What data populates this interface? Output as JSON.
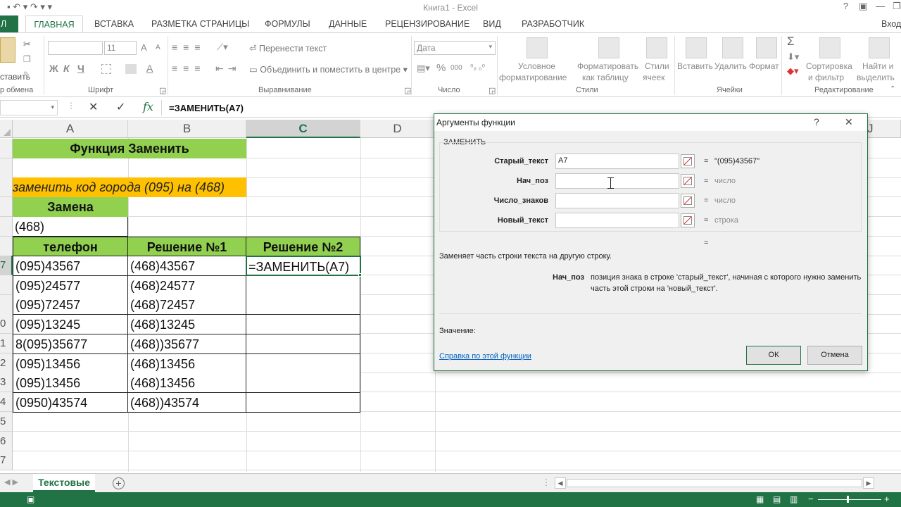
{
  "window": {
    "title": "Книга1 - Excel",
    "help_label": "?",
    "login_label": "Вход"
  },
  "ribbon_tabs": [
    "ЙЛ",
    "ГЛАВНАЯ",
    "ВСТАВКА",
    "РАЗМЕТКА СТРАНИЦЫ",
    "ФОРМУЛЫ",
    "ДАННЫЕ",
    "РЕЦЕНЗИРОВАНИЕ",
    "ВИД",
    "РАЗРАБОТЧИК"
  ],
  "ribbon": {
    "clipboard": {
      "paste_label": "ставить",
      "group_label": "р обмена"
    },
    "font": {
      "size": "11",
      "bold": "Ж",
      "italic": "К",
      "underline": "Ч",
      "grow": "A",
      "shrink": "A",
      "color": "A",
      "group_label": "Шрифт"
    },
    "alignment": {
      "wrap_label": "Перенести текст",
      "merge_label": "Объединить и поместить в центре",
      "group_label": "Выравнивание"
    },
    "number": {
      "format": "Дата",
      "percent": "%",
      "comma": "000",
      "group_label": "Число"
    },
    "styles": {
      "conditional": [
        "Условное",
        "форматирование"
      ],
      "as_table": [
        "Форматировать",
        "как таблицу"
      ],
      "cell_styles": [
        "Стили",
        "ячеек"
      ],
      "group_label": "Стили"
    },
    "cells": {
      "insert": "Вставить",
      "delete": "Удалить",
      "format": "Формат",
      "group_label": "Ячейки"
    },
    "editing": {
      "sort": [
        "Сортировка",
        "и фильтр"
      ],
      "find": [
        "Найти и",
        "выделить"
      ],
      "sum": "Σ",
      "group_label": "Редактирование"
    }
  },
  "formula_bar": {
    "cancel": "✕",
    "enter": "✓",
    "fx": "fx",
    "formula": "=ЗАМЕНИТЬ(A7)"
  },
  "grid": {
    "columns": [
      "A",
      "B",
      "C",
      "D"
    ],
    "right_col_partial": "J",
    "rows": [
      "",
      "",
      "",
      "",
      "",
      "",
      "7",
      "",
      "",
      "0",
      "1",
      "2",
      "3",
      "4",
      "5",
      "6",
      "7"
    ],
    "title_cell": "Функция Заменить",
    "subtitle_cell": "заменить код города (095) на (468)",
    "replace_header": "Замена",
    "replace_value": "(468)",
    "table_headers": [
      "телефон",
      "Решение №1",
      "Решение №2"
    ],
    "phones": [
      "(095)43567",
      "(095)24577",
      "(095)72457",
      "(095)13245",
      "8(095)35677",
      "(095)13456",
      "(095)13456",
      "(0950)43574"
    ],
    "solution1": [
      "(468)43567",
      "(468)24577",
      "(468)72457",
      "(468)13245",
      "(468))35677",
      "(468)13456",
      "(468)13456",
      "(468))43574"
    ],
    "active_formula": "=ЗАМЕНИТЬ(A7)"
  },
  "sheet_tabs": {
    "active": "Текстовые",
    "add": "+"
  },
  "dialog": {
    "title": "Аргументы функции",
    "help": "?",
    "close": "✕",
    "function_name": "ЗАМЕНИТЬ",
    "args": [
      {
        "name": "Старый_текст",
        "value": "A7",
        "result": "\"(095)43567\""
      },
      {
        "name": "Нач_поз",
        "value": "",
        "result": "число"
      },
      {
        "name": "Число_знаков",
        "value": "",
        "result": "число"
      },
      {
        "name": "Новый_текст",
        "value": "",
        "result": "строка"
      }
    ],
    "eq_sign": "=",
    "summary": "Заменяет часть строки текста на другую строку.",
    "current_arg_name": "Нач_поз",
    "current_arg_desc_1": "позиция знака в строке 'старый_текст', начиная с которого нужно заменить",
    "current_arg_desc_2": "часть этой строки на 'новый_текст'.",
    "value_label": "Значение:",
    "help_link": "Справка по этой функции",
    "ok": "ОК",
    "cancel": "Отмена"
  },
  "colors": {
    "accent": "#217346",
    "green_fill": "#92d050",
    "yellow_fill": "#ffc000"
  }
}
